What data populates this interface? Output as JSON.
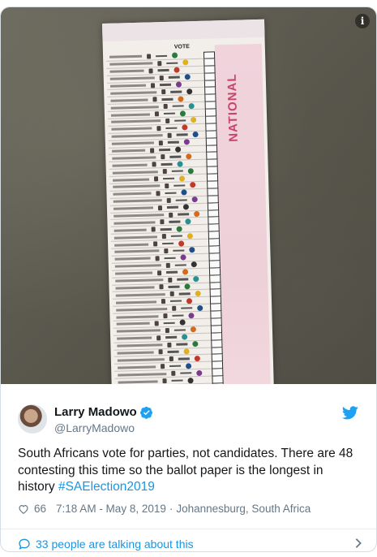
{
  "photo": {
    "alt_subject": "ballot",
    "ballot_vote_label": "VOTE",
    "ballot_side_label": "NATIONAL",
    "ballot_row_count": 48,
    "info_icon": "info-icon"
  },
  "tweet": {
    "author_name": "Larry Madowo",
    "author_handle": "@LarryMadowo",
    "text_before_tag": "South Africans vote for parties, not candidates. There are 48 contesting this time so the ballot paper is the longest in history ",
    "hashtag": "#SAElection2019",
    "likes": "66",
    "timestamp": "7:18 AM - May 8, 2019",
    "separator": "·",
    "location": "Johannesburg, South Africa",
    "talking": "33 people are talking about this",
    "colors": {
      "link": "#1b95e0",
      "muted": "#657786",
      "text": "#14171a"
    },
    "icons": [
      "verified-badge-icon",
      "twitter-bird-icon",
      "heart-icon",
      "speech-bubble-icon",
      "chevron-right-icon"
    ]
  }
}
